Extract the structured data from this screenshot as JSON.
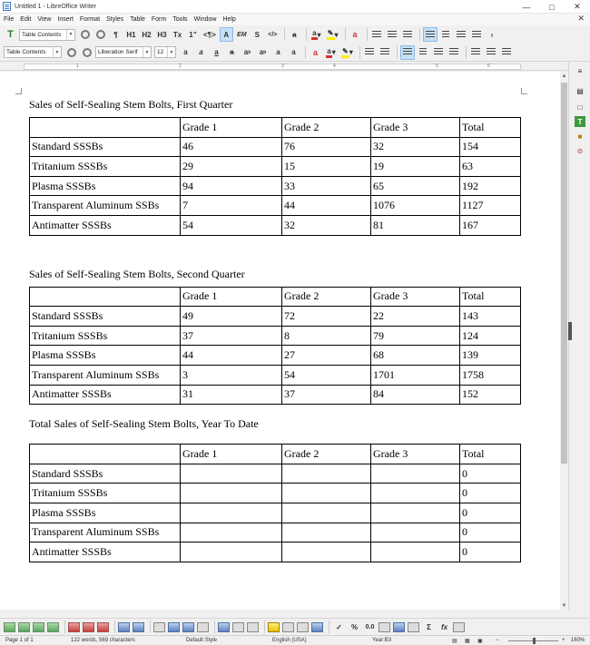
{
  "window": {
    "title": "Untitled 1 - LibreOffice Writer"
  },
  "menu": [
    "File",
    "Edit",
    "View",
    "Insert",
    "Format",
    "Styles",
    "Table",
    "Form",
    "Tools",
    "Window",
    "Help"
  ],
  "toolbar1": {
    "para_style": "Table Contents",
    "buttons": [
      "¶",
      "H1",
      "H2",
      "H3",
      "Tx",
      "1”",
      "<¶>",
      "A",
      "EM",
      "S",
      "</>"
    ]
  },
  "toolbar2": {
    "para_style": "Table Contents",
    "font_name": "Liberation Serif",
    "font_size": "12"
  },
  "ruler": {
    "marks": [
      "1",
      "2",
      "3",
      "4",
      "5",
      "6"
    ]
  },
  "document": {
    "sections": [
      {
        "heading": "Sales of Self-Sealing Stem Bolts, First Quarter",
        "header": [
          "",
          "Grade 1",
          "Grade 2",
          "Grade 3",
          "Total"
        ],
        "rows": [
          [
            "Standard SSSBs",
            "46",
            "76",
            "32",
            "154"
          ],
          [
            "Tritanium SSSBs",
            "29",
            "15",
            "19",
            "63"
          ],
          [
            "Plasma SSSBs",
            "94",
            "33",
            "65",
            "192"
          ],
          [
            "Transparent Aluminum SSBs",
            "7",
            "44",
            "1076",
            "1127"
          ],
          [
            "Antimatter SSSBs",
            "54",
            "32",
            "81",
            "167"
          ]
        ]
      },
      {
        "heading": "Sales of Self-Sealing Stem Bolts, Second Quarter",
        "header": [
          "",
          "Grade 1",
          "Grade 2",
          "Grade 3",
          "Total"
        ],
        "rows": [
          [
            "Standard SSSBs",
            "49",
            "72",
            "22",
            "143"
          ],
          [
            "Tritanium SSSBs",
            "37",
            "8",
            "79",
            "124"
          ],
          [
            "Plasma SSSBs",
            "44",
            "27",
            "68",
            "139"
          ],
          [
            "Transparent Aluminum SSBs",
            "3",
            "54",
            "1701",
            "1758"
          ],
          [
            "Antimatter SSSBs",
            "31",
            "37",
            "84",
            "152"
          ]
        ]
      },
      {
        "heading": "Total Sales of Self-Sealing Stem Bolts, Year To Date",
        "header": [
          "",
          "Grade 1",
          "Grade 2",
          "Grade 3",
          "Total"
        ],
        "rows": [
          [
            "Standard SSSBs",
            "",
            "",
            "",
            "0"
          ],
          [
            "Tritanium SSSBs",
            "",
            "",
            "",
            "0"
          ],
          [
            "Plasma SSSBs",
            "",
            "",
            "",
            "0"
          ],
          [
            "Transparent Aluminum SSBs",
            "",
            "",
            "",
            "0"
          ],
          [
            "Antimatter SSSBs",
            "",
            "",
            "",
            "0"
          ]
        ]
      }
    ]
  },
  "statusbar": {
    "page": "Page 1 of 1",
    "words": "122 words, 569 characters",
    "page_style": "Default Style",
    "language": "English (USA)",
    "cell": "Year:B3",
    "zoom": "160%"
  }
}
